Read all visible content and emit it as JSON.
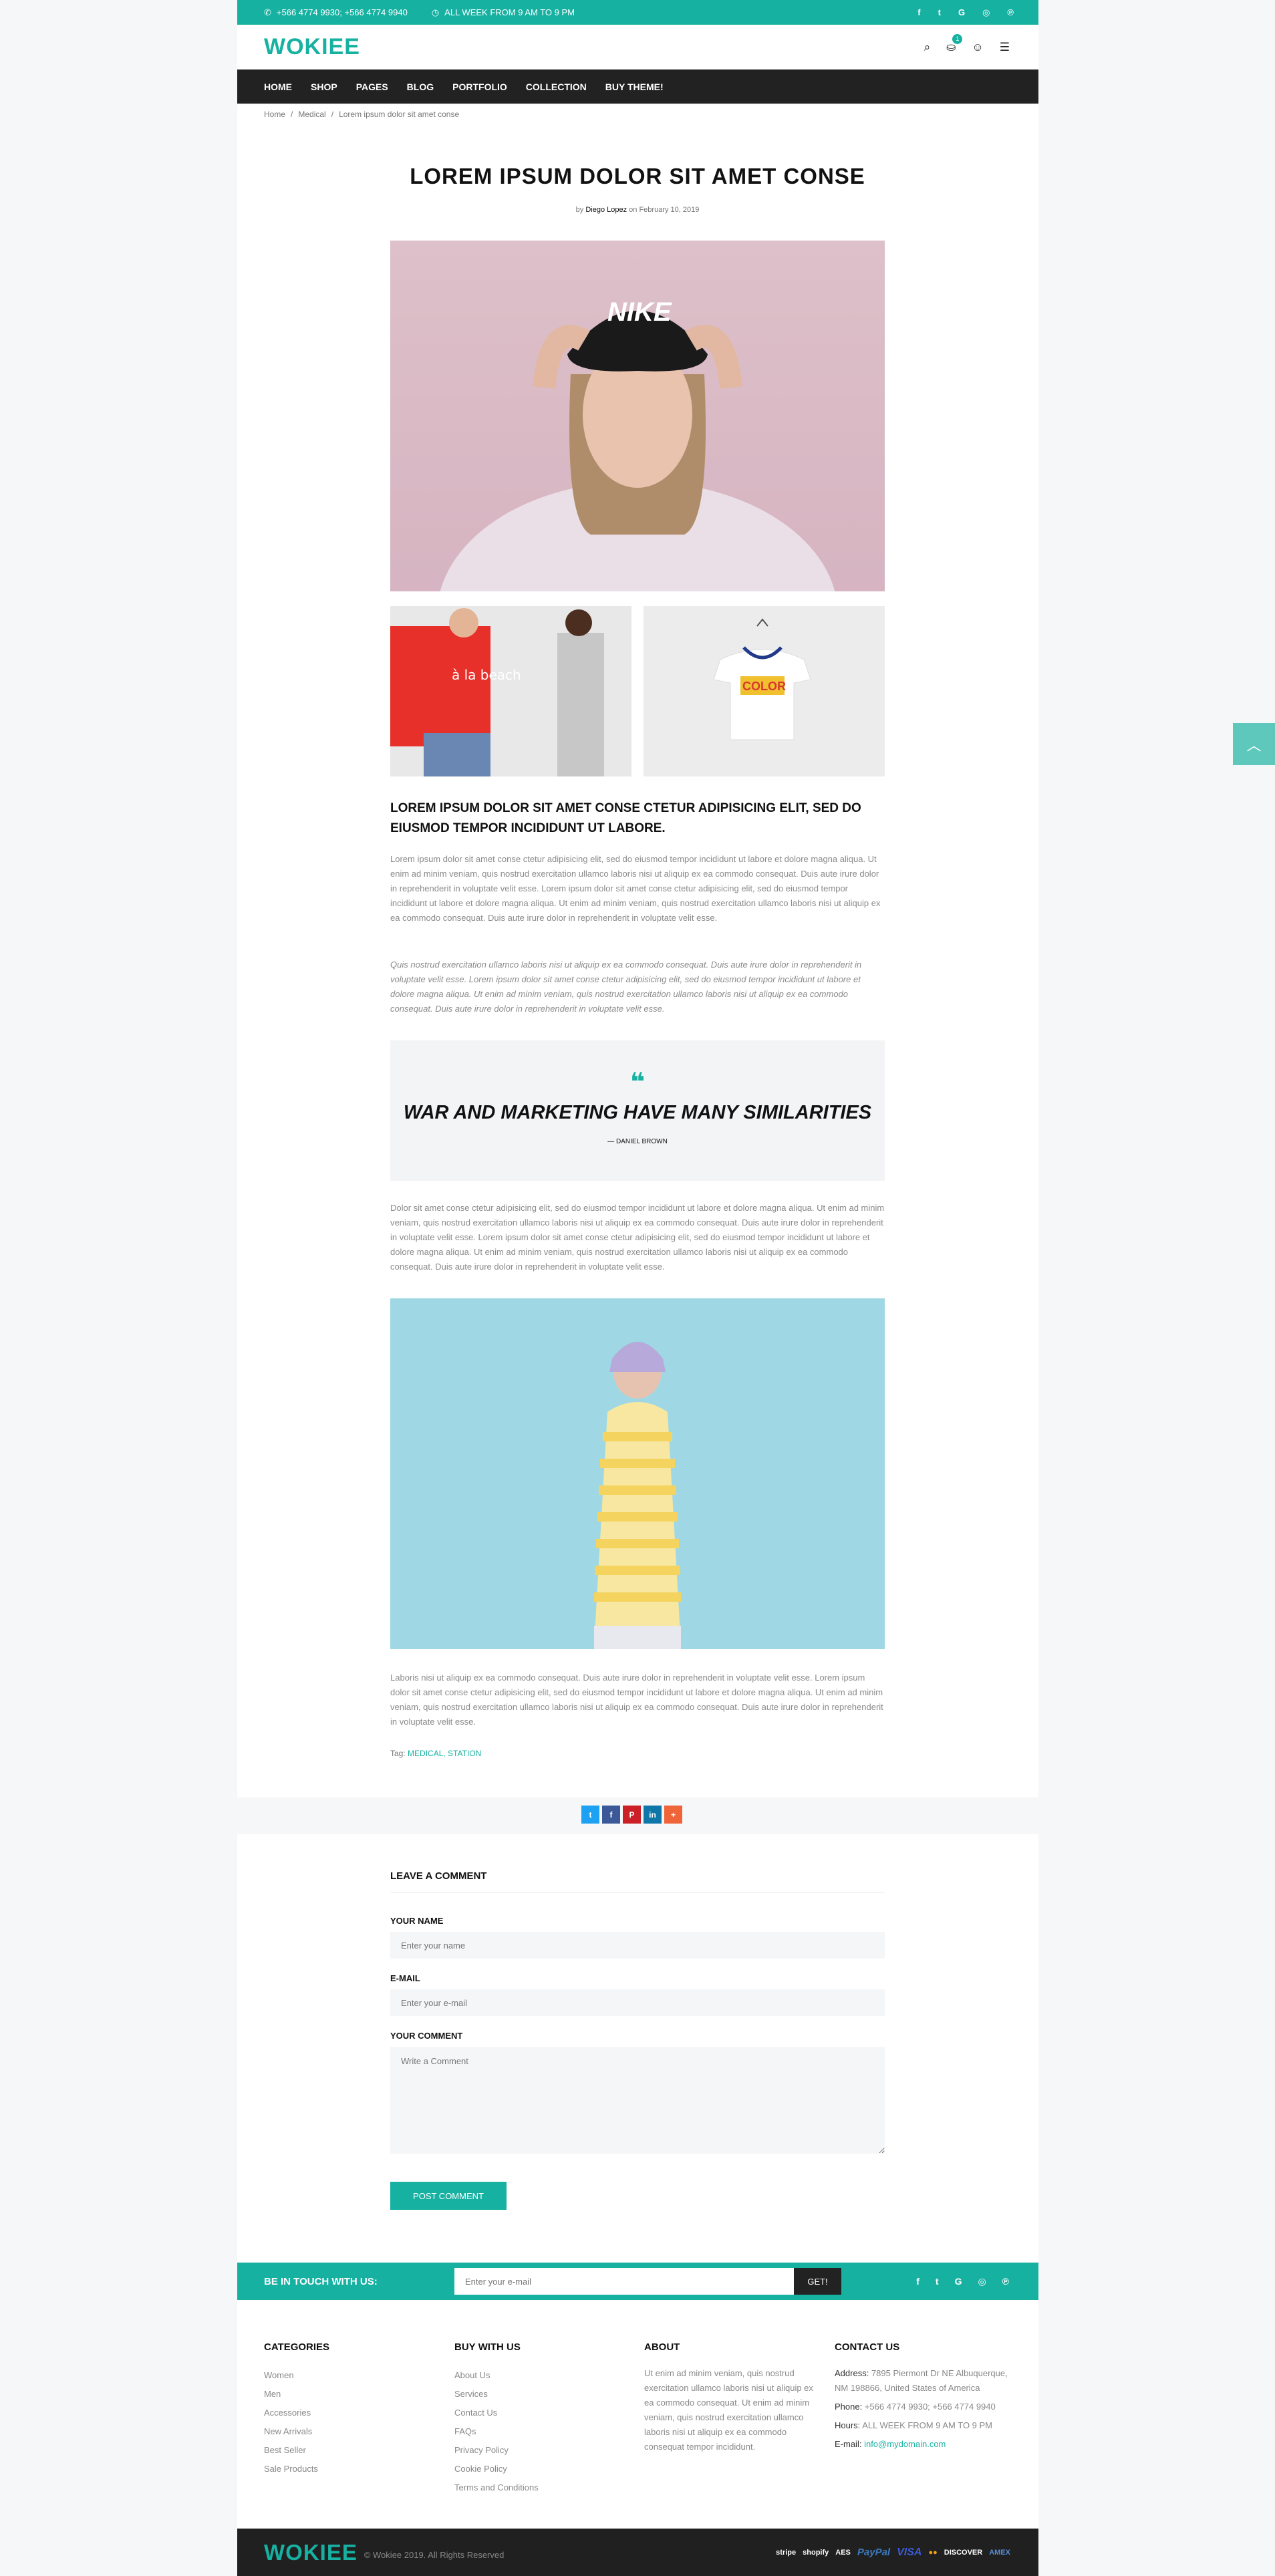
{
  "topbar": {
    "phone": "+566 4774 9930; +566 4774 9940",
    "hours": "ALL WEEK FROM 9 AM TO 9 PM",
    "social": [
      "f",
      "t",
      "G",
      "◎",
      "℗"
    ]
  },
  "header": {
    "logo": "WOKIEE",
    "cart_count": "1"
  },
  "nav": [
    "HOME",
    "SHOP",
    "PAGES",
    "BLOG",
    "PORTFOLIO",
    "COLLECTION",
    "BUY THEME!"
  ],
  "breadcrumb": [
    "Home",
    "Medical",
    "Lorem ipsum dolor sit amet conse"
  ],
  "post": {
    "title": "LOREM IPSUM DOLOR SIT AMET CONSE",
    "by": "by",
    "author": "Diego Lopez",
    "on": "on February 10, 2019",
    "lead": "LOREM IPSUM DOLOR SIT AMET CONSE CTETUR ADIPISICING ELIT, SED DO EIUSMOD TEMPOR INCIDIDUNT UT LABORE.",
    "p1": "Lorem ipsum dolor sit amet conse ctetur adipisicing elit, sed do eiusmod tempor incididunt ut labore et dolore magna aliqua. Ut enim ad minim veniam, quis nostrud exercitation ullamco laboris nisi ut aliquip ex ea commodo consequat. Duis aute irure dolor in reprehenderit in voluptate velit esse. Lorem ipsum dolor sit amet conse ctetur adipisicing elit, sed do eiusmod tempor incididunt ut labore et dolore magna aliqua. Ut enim ad minim veniam, quis nostrud exercitation ullamco laboris nisi ut aliquip ex ea commodo consequat. Duis aute irure dolor in reprehenderit in voluptate velit esse.",
    "p2": "Quis nostrud exercitation ullamco laboris nisi ut aliquip ex ea commodo consequat. Duis aute irure dolor in reprehenderit in voluptate velit esse. Lorem ipsum dolor sit amet conse ctetur adipisicing elit, sed do eiusmod tempor incididunt ut labore et dolore magna aliqua. Ut enim ad minim veniam, quis nostrud exercitation ullamco laboris nisi ut aliquip ex ea commodo consequat. Duis aute irure dolor in reprehenderit in voluptate velit esse.",
    "quote_mark": "❝",
    "quote": "WAR AND MARKETING HAVE MANY SIMILARITIES",
    "quote_author": "— DANIEL BROWN",
    "p3": "Dolor sit amet conse ctetur adipisicing elit, sed do eiusmod tempor incididunt ut labore et dolore magna aliqua. Ut enim ad minim veniam, quis nostrud exercitation ullamco laboris nisi ut aliquip ex ea commodo consequat. Duis aute irure dolor in reprehenderit in voluptate velit esse. Lorem ipsum dolor sit amet conse ctetur adipisicing elit, sed do eiusmod tempor incididunt ut labore et dolore magna aliqua. Ut enim ad minim veniam, quis nostrud exercitation ullamco laboris nisi ut aliquip ex ea commodo consequat. Duis aute irure dolor in reprehenderit in voluptate velit esse.",
    "p4": "Laboris nisi ut aliquip ex ea commodo consequat. Duis aute irure dolor in reprehenderit in voluptate velit esse. Lorem ipsum dolor sit amet conse ctetur adipisicing elit, sed do eiusmod tempor incididunt ut labore et dolore magna aliqua. Ut enim ad minim veniam, quis nostrud exercitation ullamco laboris nisi ut aliquip ex ea commodo consequat. Duis aute irure dolor in reprehenderit in voluptate velit esse.",
    "tags_label": "Tag:",
    "tags": "MEDICAL, STATION",
    "image_text": {
      "logo": "NIKE",
      "shirt": "à la beach",
      "tee": "COLOR"
    }
  },
  "share": [
    {
      "t": "t",
      "c": "#1da1f2"
    },
    {
      "t": "f",
      "c": "#3b5998"
    },
    {
      "t": "P",
      "c": "#cb2027"
    },
    {
      "t": "in",
      "c": "#0e76a8"
    },
    {
      "t": "+",
      "c": "#f0643a"
    }
  ],
  "comment": {
    "heading": "LEAVE A COMMENT",
    "name_label": "YOUR NAME",
    "name_ph": "Enter your name",
    "email_label": "E-MAIL",
    "email_ph": "Enter your e-mail",
    "comment_label": "YOUR COMMENT",
    "comment_ph": "Write a Comment",
    "submit": "POST COMMENT"
  },
  "newsletter": {
    "title": "BE IN TOUCH WITH US:",
    "placeholder": "Enter your e-mail",
    "button": "GET!"
  },
  "footer": {
    "categories": {
      "title": "CATEGORIES",
      "items": [
        "Women",
        "Men",
        "Accessories",
        "New Arrivals",
        "Best Seller",
        "Sale Products"
      ]
    },
    "buy": {
      "title": "BUY WITH US",
      "items": [
        "About Us",
        "Services",
        "Contact Us",
        "FAQs",
        "Privacy Policy",
        "Cookie Policy",
        "Terms and Conditions"
      ]
    },
    "about": {
      "title": "ABOUT",
      "text": "Ut enim ad minim veniam, quis nostrud exercitation ullamco laboris nisi ut aliquip ex ea commodo consequat. Ut enim ad minim veniam, quis nostrud exercitation ullamco laboris nisi ut aliquip ex ea commodo consequat tempor incididunt."
    },
    "contact": {
      "title": "CONTACT US",
      "address_k": "Address:",
      "address_v": "7895 Piermont Dr NE Albuquerque, NM 198866, United States of America",
      "phone_k": "Phone:",
      "phone_v": "+566 4774 9930; +566 4774 9940",
      "hours_k": "Hours:",
      "hours_v": "ALL WEEK FROM 9 AM TO 9 PM",
      "email_k": "E-mail:",
      "email_v": "info@mydomain.com"
    }
  },
  "bottom": {
    "logo": "WOKIEE",
    "copyright": "© Wokiee 2019. All Rights Reserved",
    "payments": [
      "stripe",
      "shopify",
      "AES",
      "PayPal",
      "VISA",
      "●●",
      "DISCOVER",
      "AMEX"
    ]
  },
  "colors": {
    "accent": "#17b1a2",
    "dark": "#222222"
  }
}
